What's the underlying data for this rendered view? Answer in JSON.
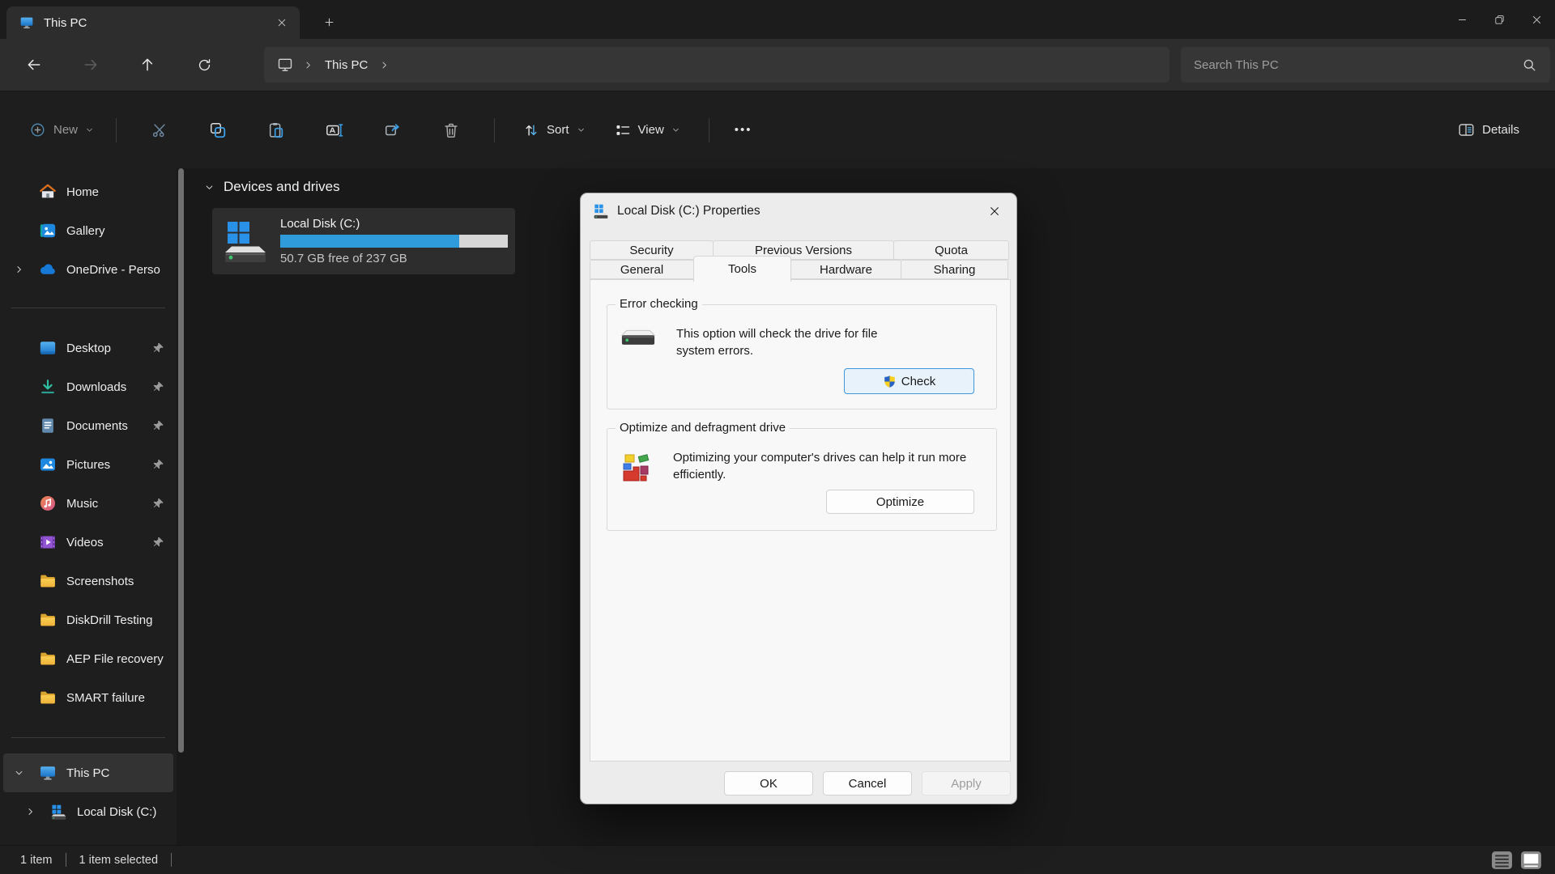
{
  "titlebar": {
    "tab_title": "This PC"
  },
  "navbar": {
    "breadcrumb_root": "This PC",
    "search_placeholder": "Search This PC"
  },
  "toolbar": {
    "new": "New",
    "sort": "Sort",
    "view": "View",
    "more": "•••",
    "details": "Details"
  },
  "sidebar": {
    "items": [
      {
        "label": "Home"
      },
      {
        "label": "Gallery"
      },
      {
        "label": "OneDrive - Perso"
      },
      {
        "label": "Desktop",
        "pinned": true
      },
      {
        "label": "Downloads",
        "pinned": true
      },
      {
        "label": "Documents",
        "pinned": true
      },
      {
        "label": "Pictures",
        "pinned": true
      },
      {
        "label": "Music",
        "pinned": true
      },
      {
        "label": "Videos",
        "pinned": true
      },
      {
        "label": "Screenshots"
      },
      {
        "label": "DiskDrill Testing"
      },
      {
        "label": "AEP File recovery"
      },
      {
        "label": "SMART failure"
      },
      {
        "label": "This PC",
        "selected": true
      },
      {
        "label": "Local Disk (C:)"
      }
    ]
  },
  "main": {
    "section_header": "Devices and drives",
    "drive": {
      "name": "Local Disk (C:)",
      "caption": "50.7 GB free of 237 GB",
      "used_percent": 78.6
    }
  },
  "statusbar": {
    "count": "1 item",
    "selection": "1 item selected"
  },
  "dialog": {
    "title": "Local Disk (C:) Properties",
    "tabs_row1": [
      {
        "label": "Security"
      },
      {
        "label": "Previous Versions"
      },
      {
        "label": "Quota"
      }
    ],
    "tabs_row2": [
      {
        "label": "General"
      },
      {
        "label": "Tools",
        "active": true
      },
      {
        "label": "Hardware"
      },
      {
        "label": "Sharing"
      }
    ],
    "error_checking": {
      "legend": "Error checking",
      "description": "This option will check the drive for file system errors.",
      "check_button": "Check"
    },
    "optimize": {
      "legend": "Optimize and defragment drive",
      "description": "Optimizing your computer's drives can help it run more efficiently.",
      "optimize_button": "Optimize"
    },
    "footer": {
      "ok": "OK",
      "cancel": "Cancel",
      "apply": "Apply",
      "apply_disabled": true
    }
  },
  "icons": {
    "new": "plus-circle",
    "cut": "scissors",
    "copy": "overlapping-squares",
    "paste": "clipboard",
    "rename": "letter-a-with-cursor",
    "share": "box-with-arrow",
    "delete": "trash-can",
    "sort": "arrows-up-down",
    "view": "list-squares",
    "details": "split-panel",
    "search": "magnifier",
    "back": "arrow-left",
    "forward": "arrow-right",
    "up": "arrow-up",
    "refresh": "circular-arrow",
    "check_button": "uac-shield"
  },
  "colors": {
    "progress_fill": "#2f9bdb",
    "windows_blue": "#2a91e8",
    "check_border": "#3f97dd",
    "selection_bg": "#333333",
    "folder_yellow": "#f2bf43"
  }
}
